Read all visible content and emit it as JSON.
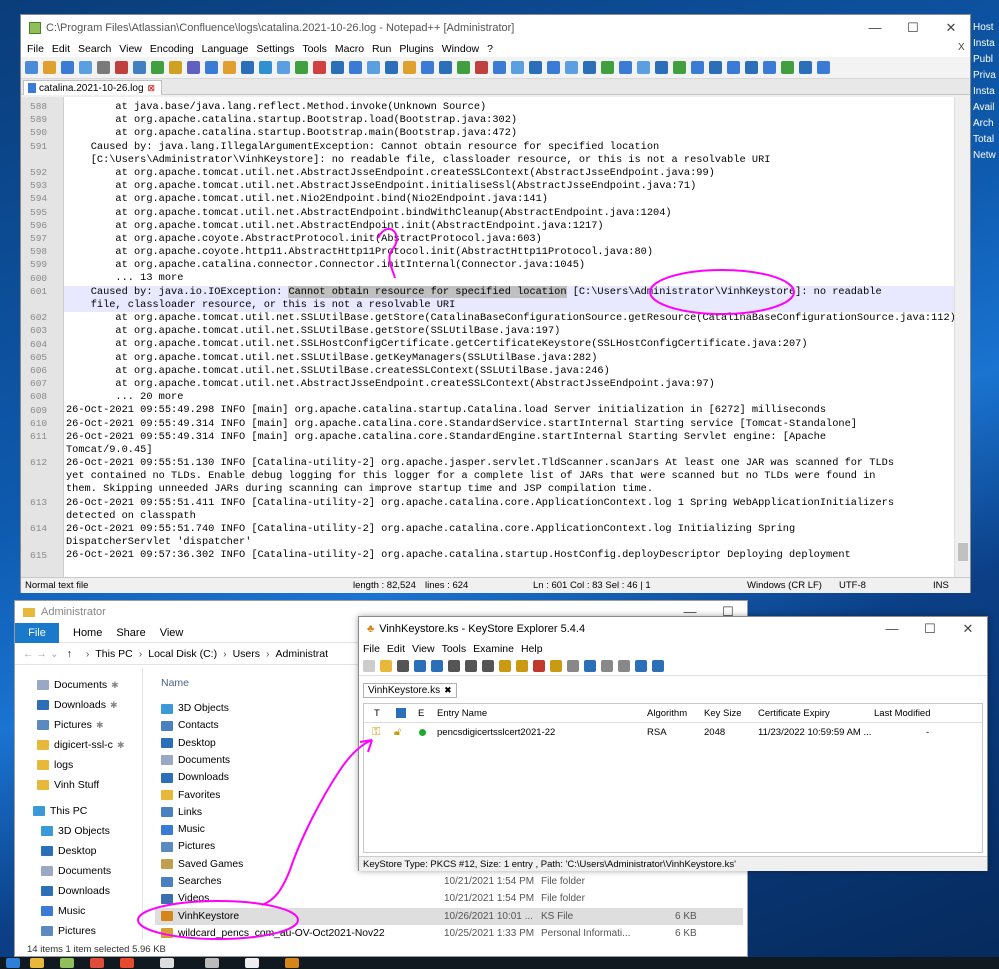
{
  "desktop_info": [
    "Host",
    "Insta",
    "Publ",
    "Priva",
    "Insta",
    "Avail",
    "Arch",
    "Total",
    "Netw"
  ],
  "notepad": {
    "title": "C:\\Program Files\\Atlassian\\Confluence\\logs\\catalina.2021-10-26.log - Notepad++ [Administrator]",
    "menu": [
      "File",
      "Edit",
      "Search",
      "View",
      "Encoding",
      "Language",
      "Settings",
      "Tools",
      "Macro",
      "Run",
      "Plugins",
      "Window",
      "?"
    ],
    "tab": "catalina.2021-10-26.log",
    "close_x": "X",
    "rows": [
      {
        "n": "588",
        "t": "        at java.base/java.lang.reflect.Method.invoke(Unknown Source)"
      },
      {
        "n": "589",
        "t": "        at org.apache.catalina.startup.Bootstrap.load(Bootstrap.java:302)"
      },
      {
        "n": "590",
        "t": "        at org.apache.catalina.startup.Bootstrap.main(Bootstrap.java:472)"
      },
      {
        "n": "591",
        "t": "    Caused by: java.lang.IllegalArgumentException: Cannot obtain resource for specified location"
      },
      {
        "n": "",
        "t": "    [C:\\Users\\Administrator\\VinhKeystore]: no readable file, classloader resource, or this is not a resolvable URI"
      },
      {
        "n": "592",
        "t": "        at org.apache.tomcat.util.net.AbstractJsseEndpoint.createSSLContext(AbstractJsseEndpoint.java:99)"
      },
      {
        "n": "593",
        "t": "        at org.apache.tomcat.util.net.AbstractJsseEndpoint.initialiseSsl(AbstractJsseEndpoint.java:71)"
      },
      {
        "n": "594",
        "t": "        at org.apache.tomcat.util.net.Nio2Endpoint.bind(Nio2Endpoint.java:141)"
      },
      {
        "n": "595",
        "t": "        at org.apache.tomcat.util.net.AbstractEndpoint.bindWithCleanup(AbstractEndpoint.java:1204)"
      },
      {
        "n": "596",
        "t": "        at org.apache.tomcat.util.net.AbstractEndpoint.init(AbstractEndpoint.java:1217)"
      },
      {
        "n": "597",
        "t": "        at org.apache.coyote.AbstractProtocol.init(AbstractProtocol.java:603)"
      },
      {
        "n": "598",
        "t": "        at org.apache.coyote.http11.AbstractHttp11Protocol.init(AbstractHttp11Protocol.java:80)"
      },
      {
        "n": "599",
        "t": "        at org.apache.catalina.connector.Connector.initInternal(Connector.java:1045)"
      },
      {
        "n": "600",
        "t": "        ... 13 more"
      },
      {
        "n": "601",
        "t": "    Caused by: java.io.IOException: ",
        "sel": "Cannot obtain resource for specified location",
        "t2": " [C:\\Users\\Administrator\\VinhKeystore]: no readable",
        "hl": true
      },
      {
        "n": "",
        "t": "    file, classloader resource, or this is not a resolvable URI",
        "hl": true
      },
      {
        "n": "602",
        "t": "        at org.apache.tomcat.util.net.SSLUtilBase.getStore(CatalinaBaseConfigurationSource.getResource(CatalinaBaseConfigurationSource.java:112)"
      },
      {
        "n": "603",
        "t": "        at org.apache.tomcat.util.net.SSLUtilBase.getStore(SSLUtilBase.java:197)"
      },
      {
        "n": "604",
        "t": "        at org.apache.tomcat.util.net.SSLHostConfigCertificate.getCertificateKeystore(SSLHostConfigCertificate.java:207)"
      },
      {
        "n": "605",
        "t": "        at org.apache.tomcat.util.net.SSLUtilBase.getKeyManagers(SSLUtilBase.java:282)"
      },
      {
        "n": "606",
        "t": "        at org.apache.tomcat.util.net.SSLUtilBase.createSSLContext(SSLUtilBase.java:246)"
      },
      {
        "n": "607",
        "t": "        at org.apache.tomcat.util.net.AbstractJsseEndpoint.createSSLContext(AbstractJsseEndpoint.java:97)"
      },
      {
        "n": "608",
        "t": "        ... 20 more"
      },
      {
        "n": "609",
        "t": "26-Oct-2021 09:55:49.298 INFO [main] org.apache.catalina.startup.Catalina.load Server initialization in [6272] milliseconds"
      },
      {
        "n": "610",
        "t": "26-Oct-2021 09:55:49.314 INFO [main] org.apache.catalina.core.StandardService.startInternal Starting service [Tomcat-Standalone]"
      },
      {
        "n": "611",
        "t": "26-Oct-2021 09:55:49.314 INFO [main] org.apache.catalina.core.StandardEngine.startInternal Starting Servlet engine: [Apache"
      },
      {
        "n": "",
        "t": "Tomcat/9.0.45]"
      },
      {
        "n": "612",
        "t": "26-Oct-2021 09:55:51.130 INFO [Catalina-utility-2] org.apache.jasper.servlet.TldScanner.scanJars At least one JAR was scanned for TLDs"
      },
      {
        "n": "",
        "t": "yet contained no TLDs. Enable debug logging for this logger for a complete list of JARs that were scanned but no TLDs were found in"
      },
      {
        "n": "",
        "t": "them. Skipping unneeded JARs during scanning can improve startup time and JSP compilation time."
      },
      {
        "n": "613",
        "t": "26-Oct-2021 09:55:51.411 INFO [Catalina-utility-2] org.apache.catalina.core.ApplicationContext.log 1 Spring WebApplicationInitializers"
      },
      {
        "n": "",
        "t": "detected on classpath"
      },
      {
        "n": "614",
        "t": "26-Oct-2021 09:55:51.740 INFO [Catalina-utility-2] org.apache.catalina.core.ApplicationContext.log Initializing Spring"
      },
      {
        "n": "",
        "t": "DispatcherServlet 'dispatcher'"
      },
      {
        "n": "615",
        "t": "26-Oct-2021 09:57:36.302 INFO [Catalina-utility-2] org.apache.catalina.startup.HostConfig.deployDescriptor Deploying deployment"
      }
    ],
    "status": {
      "type": "Normal text file",
      "length": "length : 82,524",
      "lines": "lines : 624",
      "pos": "Ln : 601   Col : 83   Sel : 46 | 1",
      "eol": "Windows (CR LF)",
      "enc": "UTF-8",
      "ins": "INS"
    }
  },
  "explorer": {
    "title": "Administrator",
    "ribbon": [
      "File",
      "Home",
      "Share",
      "View"
    ],
    "address": [
      "This PC",
      "Local Disk (C:)",
      "Users",
      "Administrat"
    ],
    "name_header": "Name",
    "quick": [
      {
        "label": "Documents",
        "pin": true
      },
      {
        "label": "Downloads",
        "pin": true
      },
      {
        "label": "Pictures",
        "pin": true
      },
      {
        "label": "digicert-ssl-c",
        "pin": true
      },
      {
        "label": "logs"
      },
      {
        "label": "Vinh Stuff"
      }
    ],
    "thispc": "This PC",
    "pc": [
      "3D Objects",
      "Desktop",
      "Documents",
      "Downloads",
      "Music",
      "Pictures"
    ],
    "files": [
      {
        "name": "3D Objects"
      },
      {
        "name": "Contacts"
      },
      {
        "name": "Desktop"
      },
      {
        "name": "Documents"
      },
      {
        "name": "Downloads"
      },
      {
        "name": "Favorites"
      },
      {
        "name": "Links"
      },
      {
        "name": "Music"
      },
      {
        "name": "Pictures"
      },
      {
        "name": "Saved Games"
      },
      {
        "name": "Searches"
      },
      {
        "name": "Videos",
        "date": "10/21/2021 1:54 PM",
        "type": "File folder",
        "size": ""
      },
      {
        "name": "VinhKeystore",
        "date": "10/26/2021 10:01 ...",
        "type": "KS File",
        "size": "6 KB",
        "selected": true
      },
      {
        "name": "wildcard_pencs_com_au-OV-Oct2021-Nov22",
        "date": "10/25/2021 1:33 PM",
        "type": "Personal Informati...",
        "size": "6 KB"
      }
    ],
    "extra_row": {
      "date": "10/21/2021 1:54 PM",
      "type": "File folder"
    },
    "status": "14 items    1 item selected  5.96 KB"
  },
  "kse": {
    "title": "VinhKeystore.ks - KeyStore Explorer 5.4.4",
    "menu": [
      "File",
      "Edit",
      "View",
      "Tools",
      "Examine",
      "Help"
    ],
    "tab": "VinhKeystore.ks",
    "headers": {
      "t": "T",
      "l": "",
      "e": "E",
      "entry": "Entry Name",
      "alg": "Algorithm",
      "size": "Key Size",
      "exp": "Certificate Expiry",
      "mod": "Last Modified"
    },
    "row": {
      "entry": "pencsdigicertsslcert2021-22",
      "alg": "RSA",
      "size": "2048",
      "exp": "11/23/2022 10:59:59 AM ...",
      "mod": "-"
    },
    "status": "KeyStore Type: PKCS #12, Size: 1 entry , Path: 'C:\\Users\\Administrator\\VinhKeystore.ks'"
  },
  "colors": {
    "accent": "#1979ca",
    "annotation": "#ff00ff"
  }
}
